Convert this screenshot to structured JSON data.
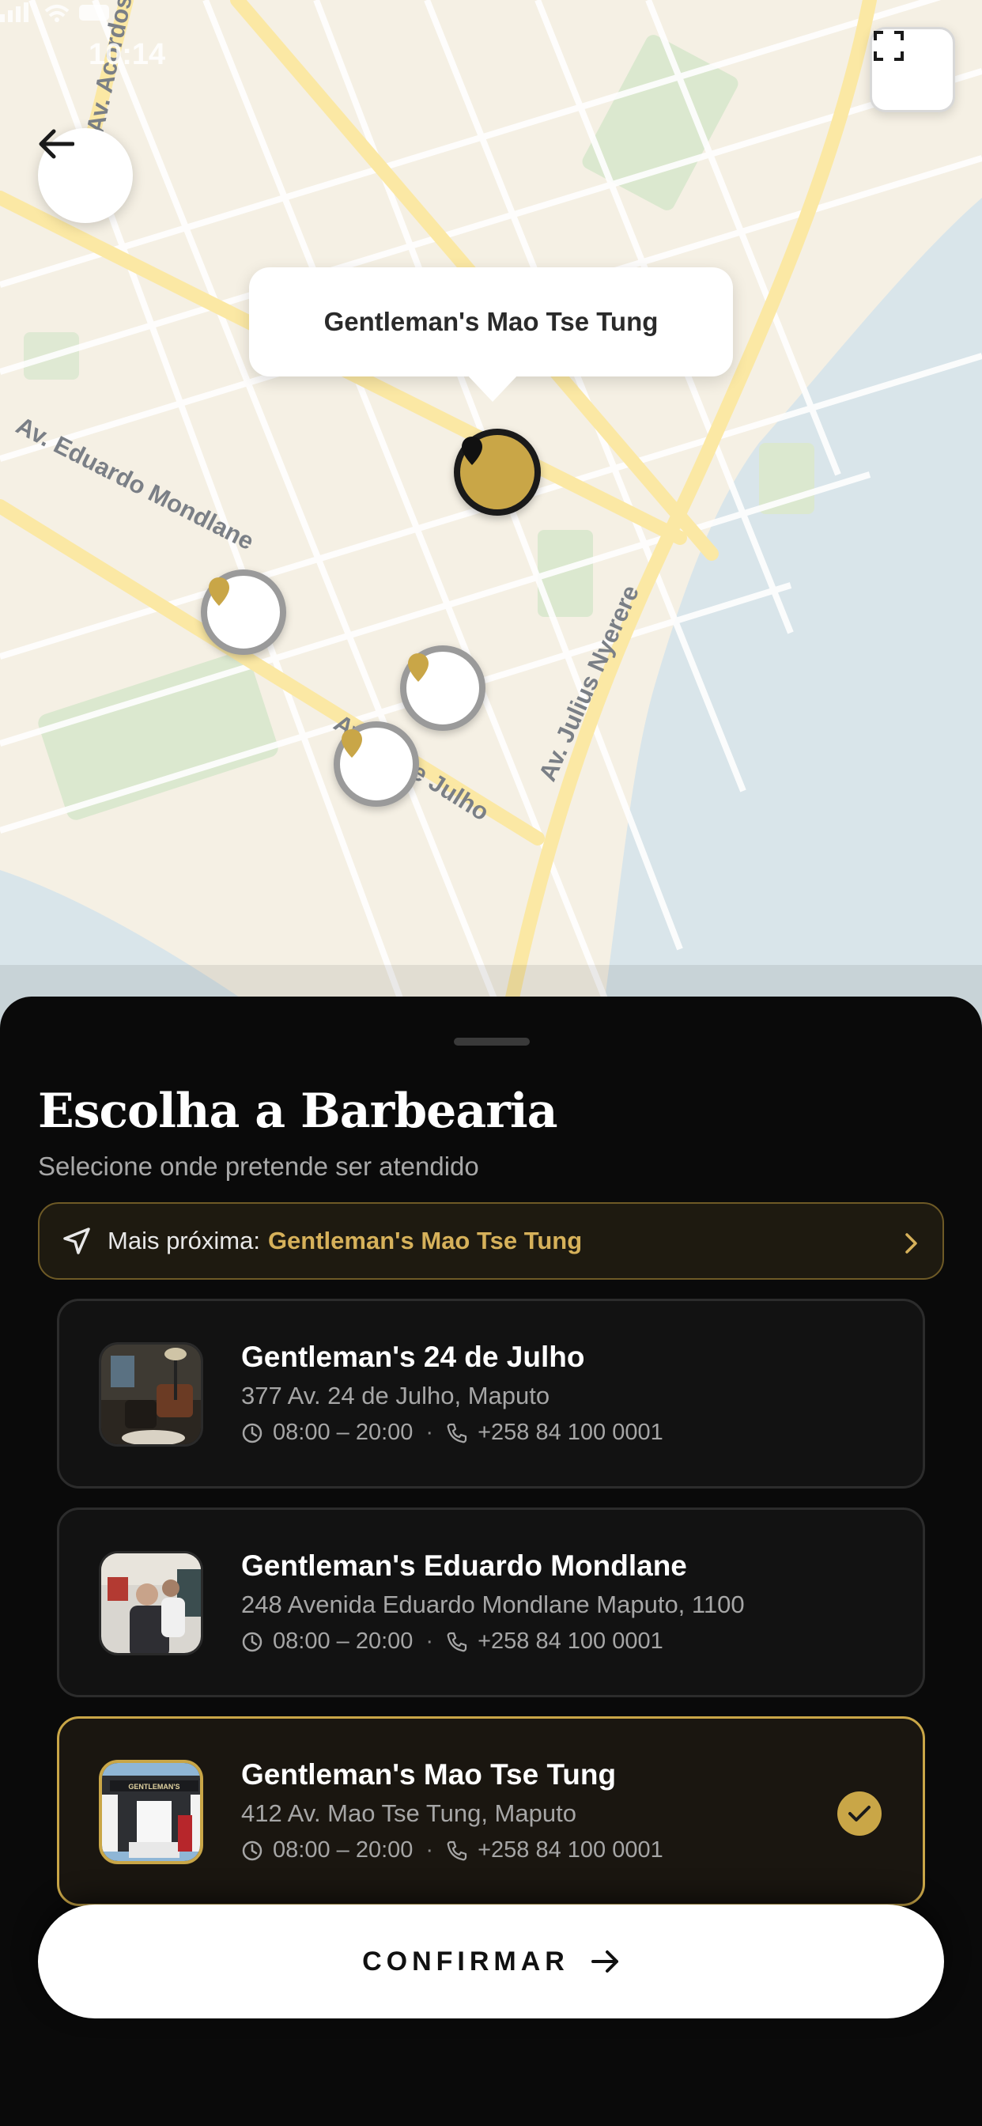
{
  "status_bar": {
    "time": "10:14"
  },
  "map": {
    "streets": [
      "Av. Eduardo Mondlane",
      "Av. 24 de Julho",
      "Av. Julius Nyerere",
      "Av. Acordos de Lusaka"
    ],
    "selected_callout": "Gentleman's Mao Tse Tung",
    "colors": {
      "land": "#f5f0e4",
      "water": "#d9e5ea",
      "park": "#dbe8cf",
      "main_road": "#fbe8a4"
    }
  },
  "sheet": {
    "title": "Escolha a Barbearia",
    "subtitle": "Selecione onde pretende ser atendido",
    "nearest": {
      "label": "Mais próxima:",
      "name": "Gentleman's Mao Tse Tung"
    },
    "branches": [
      {
        "name": "Gentleman's 24 de Julho",
        "address": "377 Av. 24 de Julho, Maputo",
        "hours": "08:00 – 20:00",
        "phone": "+258 84 100 0001",
        "selected": false
      },
      {
        "name": "Gentleman's Eduardo Mondlane",
        "address": "248 Avenida Eduardo Mondlane Maputo, 1100",
        "hours": "08:00 – 20:00",
        "phone": "+258 84 100 0001",
        "selected": false
      },
      {
        "name": "Gentleman's Mao Tse Tung",
        "address": "412 Av. Mao Tse Tung, Maputo",
        "hours": "08:00 – 20:00",
        "phone": "+258 84 100 0001",
        "selected": true
      }
    ],
    "thumb_sign": "GENTLEMAN'S",
    "confirm_label": "CONFIRMAR"
  },
  "colors": {
    "accent": "#c9a647",
    "background": "#0a0a0a",
    "card": "#121212"
  },
  "icons": [
    "arrow-left-icon",
    "fullscreen-icon",
    "map-pin-icon",
    "navigation-arrow-icon",
    "chevron-right-icon",
    "clock-icon",
    "phone-icon",
    "checkmark-icon",
    "arrow-right-icon"
  ]
}
